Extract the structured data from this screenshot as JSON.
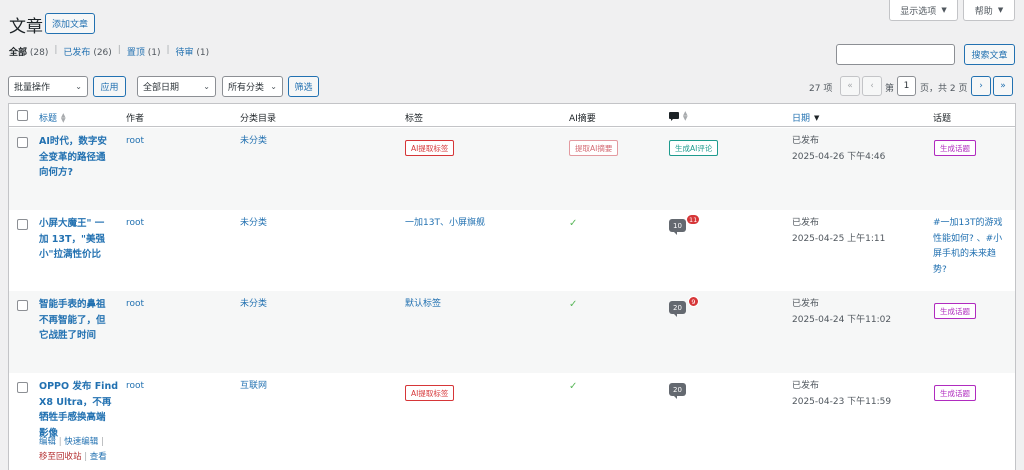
{
  "screen_tabs": {
    "options_label": "显示选项",
    "help_label": "帮助"
  },
  "header": {
    "title": "文章",
    "add_new": "添加文章"
  },
  "views": [
    {
      "label": "全部",
      "count": "(28)"
    },
    {
      "label": "已发布",
      "count": "(26)"
    },
    {
      "label": "置顶",
      "count": "(1)"
    },
    {
      "label": "待审",
      "count": "(1)"
    }
  ],
  "search": {
    "value": "",
    "button": "搜索文章"
  },
  "filters": {
    "bulk_action": "批量操作",
    "apply": "应用",
    "date": "全部日期",
    "category": "所有分类",
    "filter": "筛选"
  },
  "pagination": {
    "items": "27 项",
    "first": "«",
    "prev": "‹",
    "before": "第",
    "current": "1",
    "after": "页，共 2 页",
    "next": "›",
    "last": "»"
  },
  "columns": {
    "title": "标题",
    "author": "作者",
    "categories": "分类目录",
    "tags": "标签",
    "ai_summary": "AI摘要",
    "comments_icon": "comment-icon",
    "date": "日期",
    "topics": "话题"
  },
  "posts": [
    {
      "title_lines": [
        "AI时代，数字安",
        "全变革的路径通",
        "向何方?"
      ],
      "author": "root",
      "category": "未分类",
      "tags_button": "AI提取标签",
      "ai_summary_button": "提取AI摘要",
      "comment_button": "生成AI评论",
      "status": "已发布",
      "date": "2025-04-26 下午4:46",
      "topic_button": "生成话题"
    },
    {
      "title_lines": [
        "小屏大魔王\" 一",
        "加 13T，\"美强",
        "小\"拉满性价比"
      ],
      "author": "root",
      "category": "未分类",
      "tags": "一加13T、小屏旗舰",
      "ai_summary_check": "✓",
      "comments": "10",
      "pending": "11",
      "status": "已发布",
      "date": "2025-04-25 上午1:11",
      "topic_lines": [
        "#一加13T的游戏",
        "性能如何? 、#小",
        "屏手机的未来趋",
        "势?"
      ]
    },
    {
      "title_lines": [
        "智能手表的鼻祖",
        "不再智能了，但",
        "它战胜了时间"
      ],
      "author": "root",
      "category": "未分类",
      "tags": "默认标签",
      "ai_summary_check": "✓",
      "comments": "20",
      "pending": "9",
      "status": "已发布",
      "date": "2025-04-24 下午11:02",
      "topic_button": "生成话题"
    },
    {
      "title_lines": [
        "OPPO 发布 Find",
        "X8 Ultra，不再",
        "牺牲手感换高端",
        "影像"
      ],
      "author": "root",
      "category": "互联网",
      "tags_button": "AI提取标签",
      "ai_summary_check": "✓",
      "comments": "20",
      "status": "已发布",
      "date": "2025-04-23 下午11:59",
      "topic_button": "生成话题",
      "row_actions": {
        "edit": "编辑",
        "quick_edit": "快速编辑",
        "trash": "移至回收站",
        "view": "查看"
      }
    }
  ]
}
